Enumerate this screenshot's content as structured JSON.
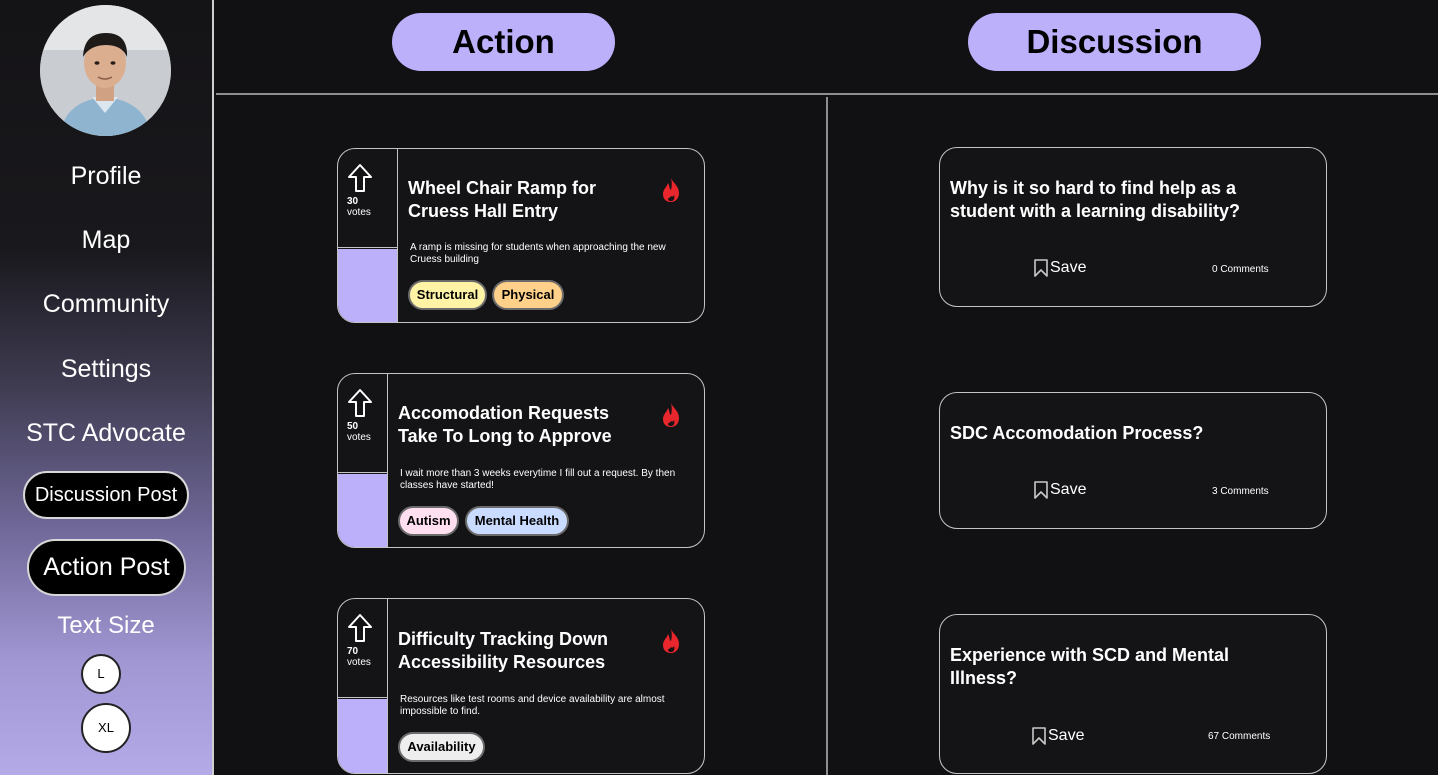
{
  "sidebar": {
    "nav": [
      "Profile",
      "Map",
      "Community",
      "Settings",
      "STC Advocate"
    ],
    "discussion_post_label": "Discussion Post",
    "action_post_label": "Action Post",
    "text_size_label": "Text Size",
    "size_l": "L",
    "size_xl": "XL"
  },
  "header": {
    "action_tab": "Action",
    "discussion_tab": "Discussion"
  },
  "colors": {
    "accent": "#bcb0fb",
    "background": "#111012",
    "flame": "#e8262b",
    "tag_structural": "#fff3a6",
    "tag_physical": "#ffd08a",
    "tag_autism": "#ffdff0",
    "tag_mental_health": "#c9dcff",
    "tag_availability": "#eeeeee"
  },
  "action_posts": [
    {
      "votes": "30",
      "votes_label": "votes",
      "title": "Wheel Chair Ramp for Cruess Hall Entry",
      "description": "A ramp is missing for students when approaching the new Cruess building",
      "tags": [
        "Structural",
        "Physical"
      ],
      "icon": "flame-icon"
    },
    {
      "votes": "50",
      "votes_label": "votes",
      "title": "Accomodation Requests Take To Long to Approve",
      "description": "I wait more than 3 weeks everytime I fill out a request. By then classes have started!",
      "tags": [
        "Autism",
        "Mental Health"
      ],
      "icon": "flame-icon"
    },
    {
      "votes": "70",
      "votes_label": "votes",
      "title": "Difficulty Tracking Down Accessibility Resources",
      "description": "Resources like test rooms and device availability are almost impossible to find.",
      "tags": [
        "Availability"
      ],
      "icon": "flame-icon"
    }
  ],
  "discussion_posts": [
    {
      "title": "Why is it so hard to find help as a student with a learning disability?",
      "save_label": "Save",
      "comments": "0 Comments"
    },
    {
      "title": "SDC Accomodation Process?",
      "save_label": "Save",
      "comments": "3 Comments"
    },
    {
      "title": "Experience with SCD and Mental Illness?",
      "save_label": "Save",
      "comments": "67 Comments"
    }
  ]
}
